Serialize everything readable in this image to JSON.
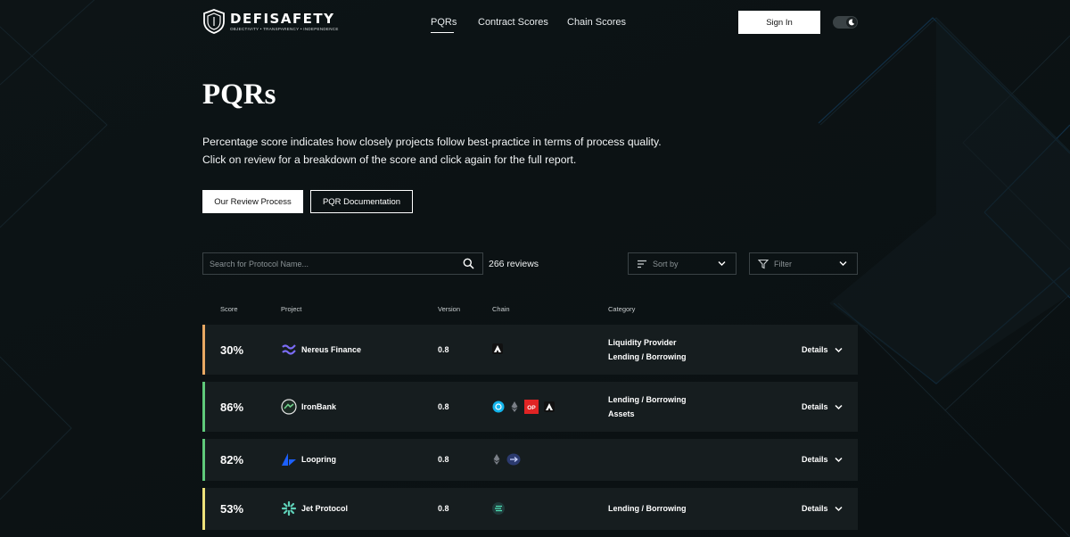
{
  "brand": {
    "name": "DEFISAFETY",
    "tagline": "OBJECTIVITY • TRANSPARENCY • INDEPENDENCE"
  },
  "nav": {
    "items": [
      {
        "label": "PQRs",
        "active": true
      },
      {
        "label": "Contract Scores"
      },
      {
        "label": "Chain Scores"
      }
    ],
    "signin_label": "Sign In",
    "theme_toggle_icon": "moon-icon"
  },
  "hero": {
    "title": "PQRs",
    "description": "Percentage score indicates how closely projects follow best-practice in terms of process quality. Click on review for a breakdown of the score and click again for the full report.",
    "review_button": "Our Review Process",
    "doc_button": "PQR Documentation"
  },
  "controls": {
    "search_placeholder": "Search for Protocol Name...",
    "review_count": "266 reviews",
    "sort_label": "Sort by",
    "filter_label": "Filter"
  },
  "table": {
    "headers": {
      "score": "Score",
      "project": "Project",
      "version": "Version",
      "chain": "Chain",
      "category": "Category"
    },
    "details_label": "Details",
    "rows": [
      {
        "score": "30%",
        "bar_color": "#e8a863",
        "project": "Nereus Finance",
        "icon": "nereus-icon",
        "version": "0.8",
        "chains": [
          "avalanche-icon"
        ],
        "categories": [
          "Liquidity Provider",
          "Lending / Borrowing"
        ]
      },
      {
        "score": "86%",
        "bar_color": "#5fc97a",
        "project": "IronBank",
        "icon": "ironbank-icon",
        "version": "0.8",
        "chains": [
          "fantom-icon",
          "ethereum-icon",
          "optimism-icon",
          "avalanche-icon"
        ],
        "categories": [
          "Lending / Borrowing",
          "Assets"
        ]
      },
      {
        "score": "82%",
        "bar_color": "#5fc97a",
        "project": "Loopring",
        "icon": "loopring-icon",
        "version": "0.8",
        "chains": [
          "ethereum-icon",
          "loopring-chain-icon"
        ],
        "categories": []
      },
      {
        "score": "53%",
        "bar_color": "#ede07a",
        "project": "Jet Protocol",
        "icon": "jet-protocol-icon",
        "version": "0.8",
        "chains": [
          "solana-icon"
        ],
        "categories": [
          "Lending / Borrowing"
        ]
      }
    ]
  }
}
